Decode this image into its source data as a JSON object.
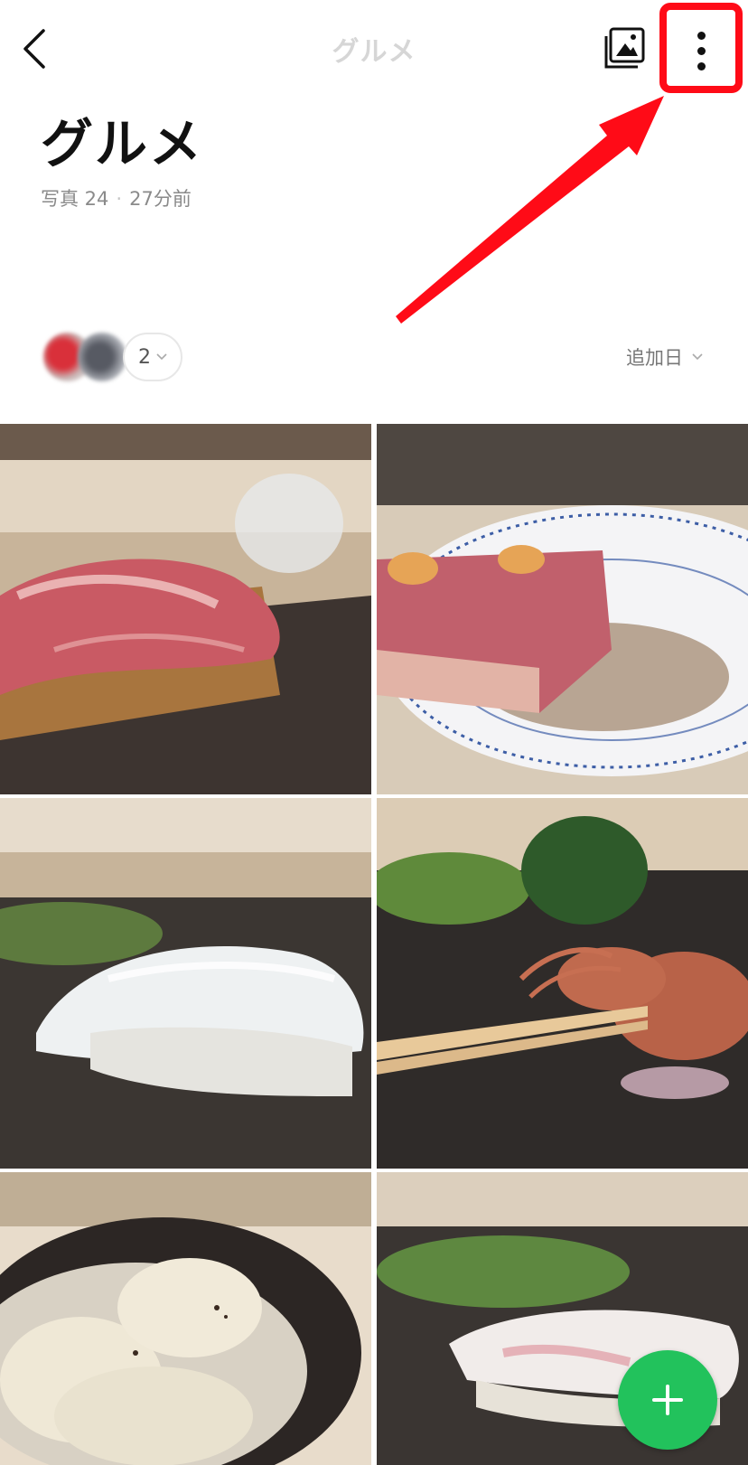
{
  "topbar": {
    "title": "グルメ",
    "back_icon": "chevron-left-icon",
    "image_icon": "photo-icon",
    "more_icon": "vertical-dots-icon",
    "highlight_color": "#ff0b17"
  },
  "album": {
    "title": "グルメ",
    "photos_label": "写真 24",
    "separator": "·",
    "updated": "27分前"
  },
  "members": {
    "count": "2"
  },
  "sort": {
    "label": "追加日"
  },
  "grid": {
    "columns": 2,
    "photos": [
      {
        "subject": "otoro-nigiri"
      },
      {
        "subject": "seared-tuna-plate"
      },
      {
        "subject": "squid-nigiri"
      },
      {
        "subject": "firefly-squid-skewer"
      },
      {
        "subject": "scallops-on-shell"
      },
      {
        "subject": "white-fish-nigiri"
      }
    ]
  },
  "fab": {
    "icon": "plus-icon",
    "color": "#22c25c"
  }
}
